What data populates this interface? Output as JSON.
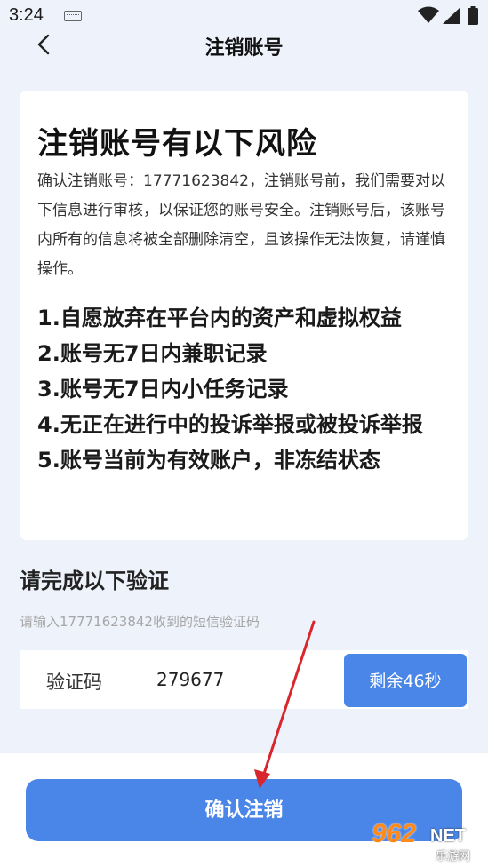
{
  "status_bar": {
    "time": "3:24",
    "icons": [
      "keyboard-icon",
      "wifi-icon",
      "signal-icon",
      "battery-icon"
    ]
  },
  "nav": {
    "back_icon": "chevron-left-icon",
    "title": "注销账号"
  },
  "risk_card": {
    "title": "注销账号有以下风险",
    "description": "确认注销账号：17771623842，注销账号前，我们需要对以下信息进行审核，以保证您的账号安全。注销账号后，该账号内所有的信息将被全部删除清空，且该操作无法恢复，请谨慎操作。",
    "items": [
      "1.自愿放弃在平台内的资产和虚拟权益",
      "2.账号无7日内兼职记录",
      "3.账号无7日内小任务记录",
      "4.无正在进行中的投诉举报或被投诉举报",
      "5.账号当前为有效账户，非冻结状态"
    ]
  },
  "verification": {
    "title": "请完成以下验证",
    "hint": "请输入17771623842收到的短信验证码",
    "code_label": "验证码",
    "code_value": "279677",
    "countdown_label": "剩余46秒"
  },
  "confirm_button": "确认注销",
  "watermark": {
    "big": "962",
    "net": "NET",
    "sub": "乐游网"
  },
  "colors": {
    "accent": "#4a86e8",
    "background": "#eef2fa",
    "annotation_arrow": "#d9262c"
  }
}
